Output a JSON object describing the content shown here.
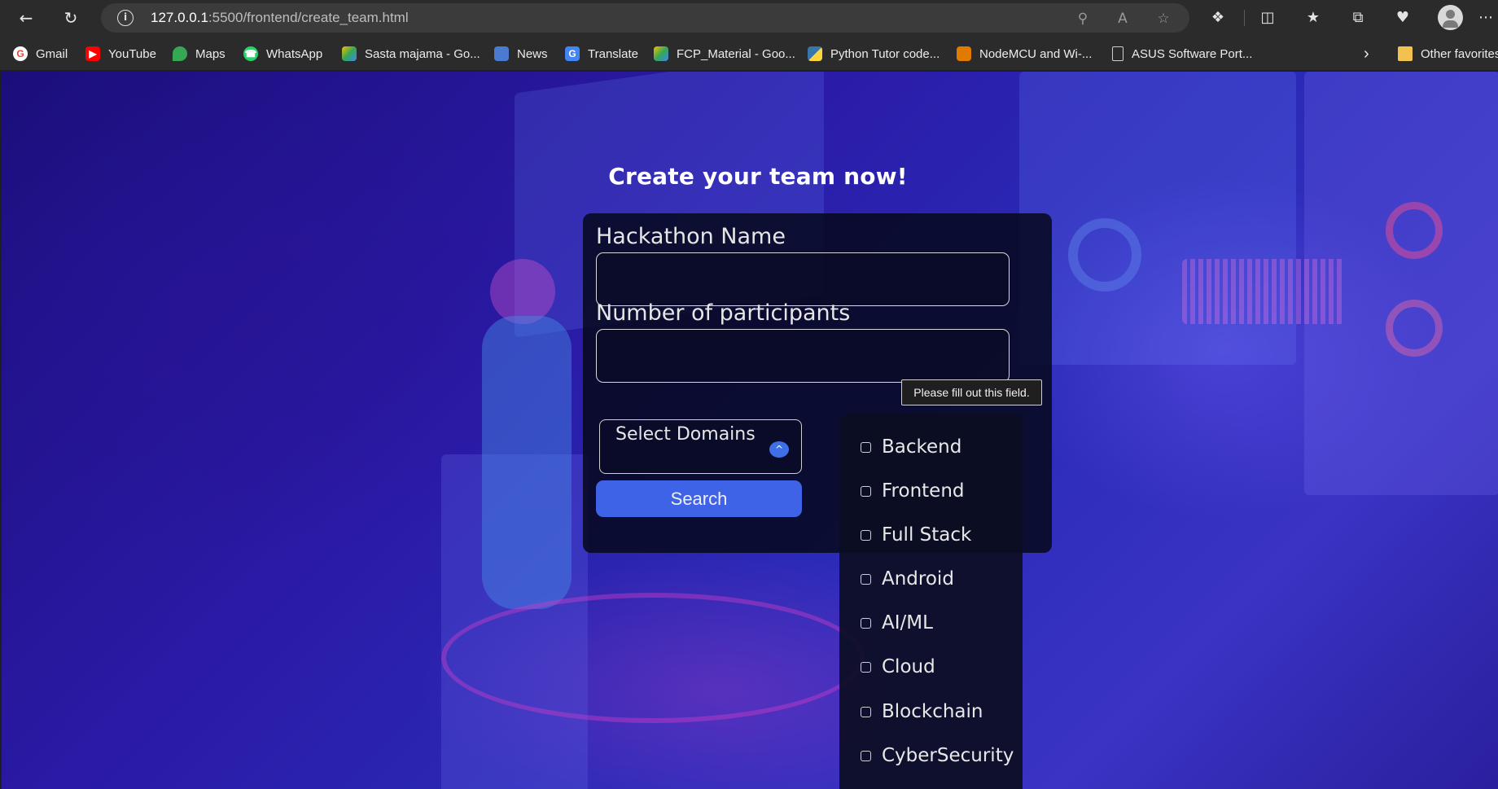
{
  "browser": {
    "url_host": "127.0.0.1",
    "url_rest": ":5500/frontend/create_team.html",
    "bookmarks": [
      {
        "label": "Gmail",
        "icon": "gmail-icon",
        "color": "#ea4335"
      },
      {
        "label": "YouTube",
        "icon": "youtube-icon",
        "color": "#ff0000"
      },
      {
        "label": "Maps",
        "icon": "maps-icon",
        "color": "#34a853"
      },
      {
        "label": "WhatsApp",
        "icon": "whatsapp-icon",
        "color": "#25d366"
      },
      {
        "label": "Sasta majama - Go...",
        "icon": "drive-icon",
        "color": "#fbbc04"
      },
      {
        "label": "News",
        "icon": "news-icon",
        "color": "#4a7bd0"
      },
      {
        "label": "Translate",
        "icon": "translate-icon",
        "color": "#4285f4"
      },
      {
        "label": "FCP_Material - Goo...",
        "icon": "drive-icon",
        "color": "#fbbc04"
      },
      {
        "label": "Python Tutor code...",
        "icon": "python-icon",
        "color": "#3776ab"
      },
      {
        "label": "NodeMCU and Wi-...",
        "icon": "nodemcu-icon",
        "color": "#e07b00"
      },
      {
        "label": "ASUS Software Port...",
        "icon": "page-icon",
        "color": "#5a5a5a"
      },
      {
        "label": "Other favorites",
        "icon": "folder-icon",
        "color": "#f2c14e"
      }
    ]
  },
  "page": {
    "title": "Create your team now!",
    "hackathon_label": "Hackathon Name",
    "participants_label": "Number of participants",
    "select_label": "Select Domains",
    "search_label": "Search",
    "tooltip": "Please fill out this field.",
    "domains": [
      "Backend",
      "Frontend",
      "Full Stack",
      "Android",
      "AI/ML",
      "Cloud",
      "Blockchain",
      "CyberSecurity"
    ]
  },
  "colors": {
    "accent": "#3f63e6",
    "card_bg": "#06081c",
    "page_bg": "#2a1aa6"
  }
}
